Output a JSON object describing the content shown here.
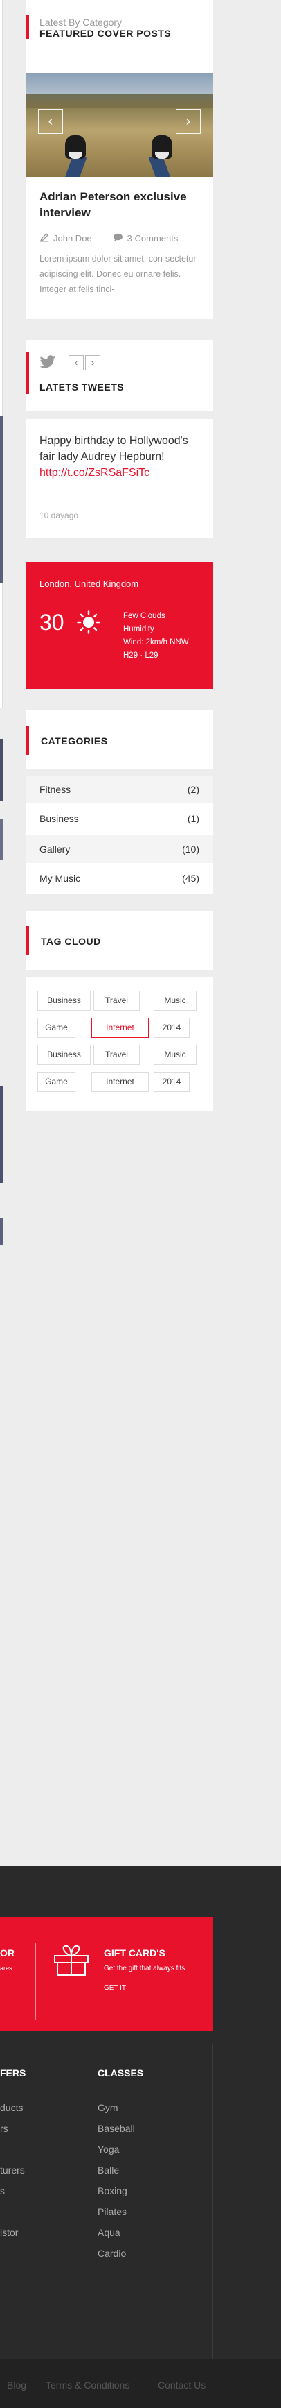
{
  "featured": {
    "subtitle": "Latest By Category",
    "title": "FEATURED COVER POSTS",
    "prev_icon": "chevron-left-icon",
    "next_icon": "chevron-right-icon",
    "post_title": "Adrian Peterson exclusive interview",
    "author": "John Doe",
    "comments": "3 Comments",
    "excerpt": "Lorem ipsum dolor sit amet, con-sectetur adipiscing elit. Donec eu ornare felis. Integer at felis tinci-"
  },
  "tweets": {
    "title": "LATETS TWEETS",
    "prev_label": "‹",
    "next_label": "›",
    "text": "Happy birthday to Hollywood's fair lady Audrey Hepburn!",
    "link": "http://t.co/ZsRSaFSiTc",
    "time": "10 dayago"
  },
  "weather": {
    "location": "London, United Kingdom",
    "temp": "30",
    "condition": "Few Clouds",
    "humidity": "Humidity",
    "wind": "Wind: 2km/h NNW",
    "hilo": "H29 · L29"
  },
  "categories": {
    "title": "CATEGORIES",
    "items": [
      {
        "name": "Fitness",
        "count": "(2)"
      },
      {
        "name": "Business",
        "count": "(1)"
      },
      {
        "name": "Gallery",
        "count": "(10)"
      },
      {
        "name": "My Music",
        "count": "(45)"
      }
    ]
  },
  "tagcloud": {
    "title": "TAG CLOUD",
    "tags": [
      "Business",
      "Travel",
      "Music",
      "Game",
      "Internet",
      "2014",
      "Business",
      "Travel",
      "Music",
      "Game",
      "Internet",
      "2014"
    ]
  },
  "footer": {
    "promo_left_title": "OR",
    "promo_left_sub": "ares",
    "gift_title": "GIFT CARD'S",
    "gift_sub": "Get the gift that always fits",
    "gift_cta": "GET IT",
    "col1_head": "FERS",
    "col1_items": [
      "ducts",
      "rs",
      "",
      "turers",
      "s",
      "",
      "istor"
    ],
    "col2_head": "CLASSES",
    "col2_items": [
      "Gym",
      "Baseball",
      "Yoga",
      "Balle",
      "Boxing",
      "Pilates",
      "Aqua",
      "Cardio"
    ]
  },
  "bottom_links": [
    "Blog",
    "Terms & Conditions",
    "Contact Us"
  ],
  "colors": {
    "accent": "#e8122d",
    "footer": "#2a2a2a"
  }
}
